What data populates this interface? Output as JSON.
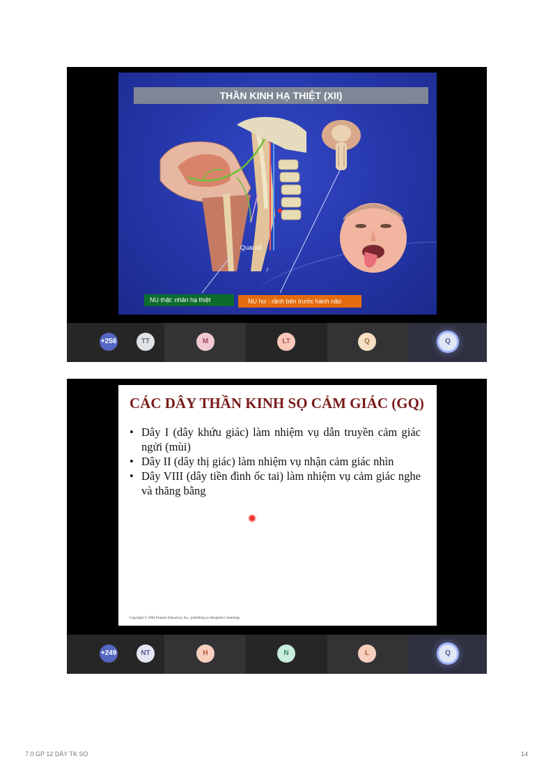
{
  "slide1": {
    "title": "THẦN KINH HẠ THIỆT (XII)",
    "label_quai": "Quai cổ",
    "label_green": "NU thật: nhân hạ thiệt",
    "label_orange": "NU hư : rãnh bên trước hành não"
  },
  "bar1": {
    "count": "+256",
    "avatars": [
      {
        "initials": "TT",
        "bg": "#dfe3e6",
        "fg": "#6e7477"
      },
      {
        "initials": "M",
        "bg": "#f3c9d2",
        "fg": "#9b4a59"
      },
      {
        "initials": "LT",
        "bg": "#f8c8bb",
        "fg": "#b05a47"
      },
      {
        "initials": "Q",
        "bg": "#f7e0c3",
        "fg": "#9a6b34"
      },
      {
        "initials": "Q",
        "bg": "#e1e6f4",
        "fg": "#4a5a8a"
      }
    ]
  },
  "slide2": {
    "title": "CÁC DÂY THẦN KINH SỌ CẢM GIÁC (GQ)",
    "bullets": [
      "Dây I (dây khứu giác) làm nhiệm vụ dẫn truyền cảm giác ngửi (mùi)",
      "Dây II (dây thị giác) làm nhiệm vụ nhận cảm giác nhìn",
      "Dây VIII (dây tiền đình ốc tai) làm nhiệm vụ cảm giác nghe và thăng bằng"
    ],
    "copyright": "Copyright © 2004 Pearson Education, Inc., publishing as Benjamin Cummings"
  },
  "bar2": {
    "count": "+249",
    "avatars": [
      {
        "initials": "NT",
        "bg": "#e3e5f3",
        "fg": "#535b8f"
      },
      {
        "initials": "H",
        "bg": "#f8cfbe",
        "fg": "#b0593c"
      },
      {
        "initials": "N",
        "bg": "#c8eddc",
        "fg": "#3f8a66"
      },
      {
        "initials": "L",
        "bg": "#f8cfbe",
        "fg": "#b0593c"
      },
      {
        "initials": "Q",
        "bg": "#e1e6f4",
        "fg": "#4a5a8a"
      }
    ]
  },
  "footer": {
    "doc_title": "7.0 GP 12 DÂY TK SỌ",
    "page_number": "14"
  },
  "colors": {
    "slide1_bg": "#2536a8",
    "slide2_title": "#7a1a1a",
    "label_green": "#0d6b2e",
    "label_orange": "#e46b0e"
  }
}
